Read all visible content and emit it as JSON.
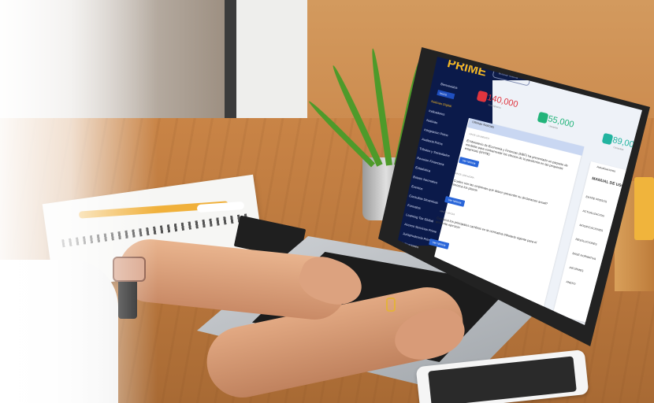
{
  "app": {
    "logo_text": "PRIME",
    "search_placeholder": "Buscar noticia"
  },
  "sidebar": {
    "items": [
      {
        "label": "Bienvenidos"
      },
      {
        "label": "Inicio"
      },
      {
        "label": "Noticias Digital"
      },
      {
        "label": "Indicadores"
      },
      {
        "label": "Noticias"
      },
      {
        "label": "Integracion Prime"
      },
      {
        "label": "Auditoria Prime"
      },
      {
        "label": "Tributos y Sociedades"
      },
      {
        "label": "Revision Financiera"
      },
      {
        "label": "Estadistica"
      },
      {
        "label": "Boletin Normativo"
      },
      {
        "label": "Eventos"
      },
      {
        "label": "Consultas Dinamicas"
      },
      {
        "label": "Formatos"
      },
      {
        "label": "Learning Tax Global"
      },
      {
        "label": "Acceso Servicios Prime"
      },
      {
        "label": "Jurisprudencia Prime"
      },
      {
        "label": "Aplicaciones"
      }
    ]
  },
  "stats": [
    {
      "value": "140,000",
      "label": "Suscriptores",
      "color": "#e0353e"
    },
    {
      "value": "55,000",
      "label": "Usuarios",
      "color": "#22b47a"
    },
    {
      "value": "89,000",
      "label": "Consultas",
      "color": "#22b4a0"
    }
  ],
  "news": {
    "header": "Ultimas Noticias",
    "items": [
      {
        "date": "HACE UN MINUTO",
        "text": "El Ministerio de Economia y Finanzas (MEF) ha presentado un paquete de medidas para contrarrestar los efectos de la pandemia en las pequenas empresas (MYPE)",
        "button": "Ver Noticia"
      },
      {
        "date": "HACE UNA HORA",
        "text": "¿Cuales son las empresas que deben presentar su declaracion anual? Conozca los plazos",
        "button": "Ver Noticia"
      },
      {
        "date": "HACE UN DIA",
        "text": "Conozca los principales cambios en la normativa tributaria vigente para el presente ejercicio",
        "button": "Ver Noticia"
      }
    ]
  },
  "side_panel": {
    "title": "Actualizaciones",
    "manual_title": "MANUAL DE USO",
    "items": [
      "ENTRE PRESOS",
      "ACTUALIZACION",
      "MODIFICACIONES",
      "RESOLUCIONES",
      "BASE NORMATIVA",
      "INFORMES",
      "ANEXO"
    ]
  }
}
